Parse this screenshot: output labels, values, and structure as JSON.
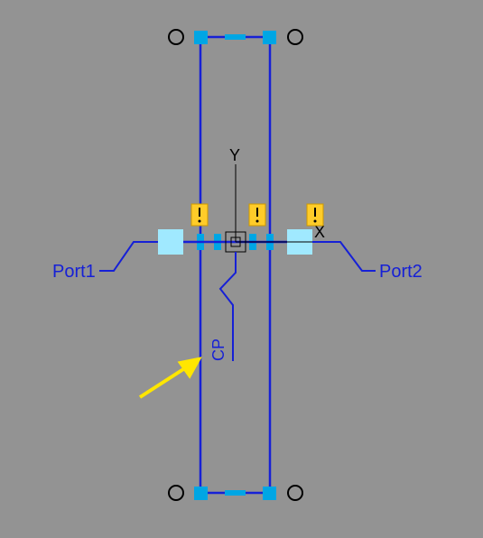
{
  "labels": {
    "port_left": "Port1",
    "port_right": "Port2",
    "cp": "CP",
    "axis_x": "X",
    "axis_y": "Y"
  },
  "colors": {
    "background": "#939393",
    "wire": "#1620d6",
    "handle": "#00a6e4",
    "pad": "#a0e9ff",
    "warning": "#ffcc29",
    "annotation_arrow": "#ffe600"
  },
  "diagram": {
    "type": "schematic",
    "ports": [
      "Port1",
      "Port2"
    ],
    "origin_marker": true,
    "warning_markers": 3,
    "corner_circles": 4,
    "edge_handles": 8
  }
}
